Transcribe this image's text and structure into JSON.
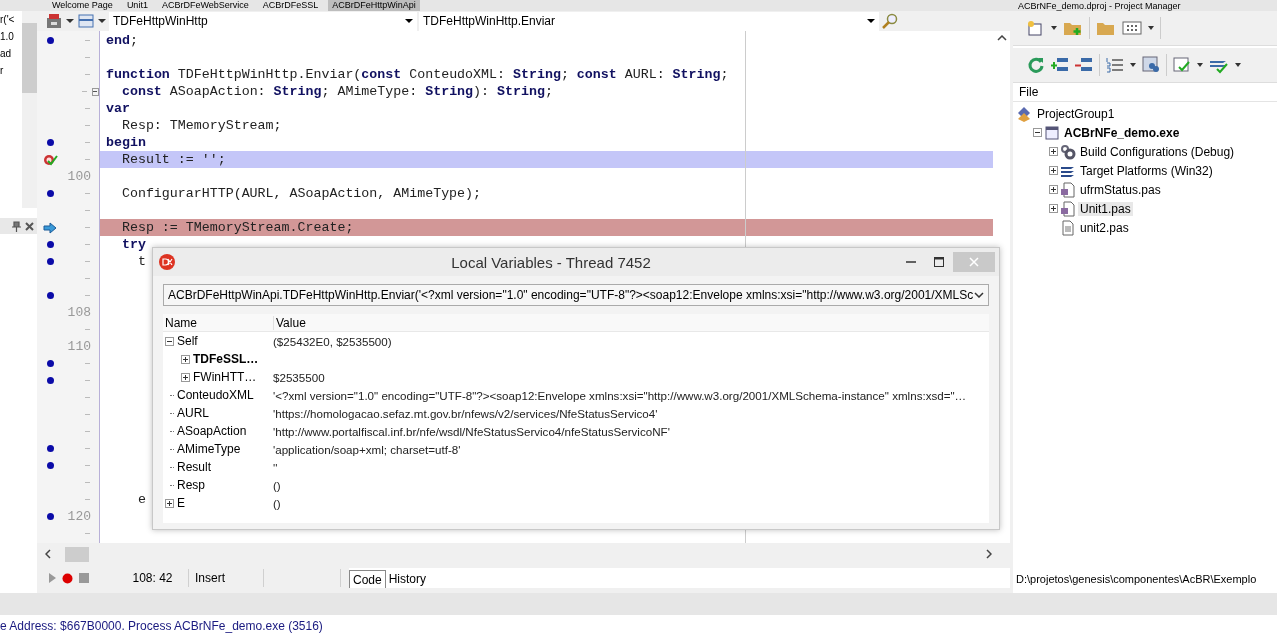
{
  "top_tabs": [
    {
      "label": "Welcome Page",
      "selected": false
    },
    {
      "label": "Unit1",
      "selected": false
    },
    {
      "label": "ACBrDFeWebService",
      "selected": false
    },
    {
      "label": "ACBrDFeSSL",
      "selected": false
    },
    {
      "label": "ACBrDFeHttpWinApi",
      "selected": true
    }
  ],
  "project_manager_title": "ACBrNFe_demo.dproj - Project Manager",
  "left_panel": {
    "lines": [
      "r('<",
      "1.0",
      "ad",
      "r"
    ]
  },
  "editor": {
    "toolbar": {
      "class_combo": "TDFeHttpWinHttp",
      "method_combo": "TDFeHttpWinHttp.Enviar"
    },
    "code_lines": [
      {
        "kind": "plain",
        "dot": true,
        "text": "**end**;"
      },
      {
        "kind": "plain",
        "dot": false
      },
      {
        "kind": "plain",
        "dot": false,
        "text": "**function** TDFeHttpWinHttp.Enviar(**const** ConteudoXML: **String**; **const** AURL: **String**;"
      },
      {
        "kind": "plain",
        "dot": false,
        "fold": true,
        "text": "  **const** ASoapAction: **String**; AMimeType: **String**): **String**;"
      },
      {
        "kind": "plain",
        "dot": false,
        "text": "**var**"
      },
      {
        "kind": "plain",
        "dot": false,
        "text": "  Resp: TMemoryStream;"
      },
      {
        "kind": "plain",
        "dot": true,
        "text": "**begin**"
      },
      {
        "kind": "breakpoint",
        "dot": false,
        "text": "  Result := '';"
      },
      {
        "kind": "plain",
        "dot": false,
        "number": "100"
      },
      {
        "kind": "plain",
        "dot": true,
        "text": "  ConfigurarHTTP(AURL, ASoapAction, AMimeType);"
      },
      {
        "kind": "plain",
        "dot": false
      },
      {
        "kind": "execution",
        "dot": false,
        "text": "  Resp := TMemoryStream.Create;"
      },
      {
        "kind": "plain",
        "dot": true,
        "text": "  **try**"
      },
      {
        "kind": "plain",
        "dot": true,
        "text": "    t"
      },
      {
        "kind": "plain",
        "dot": false
      },
      {
        "kind": "plain",
        "dot": true
      },
      {
        "kind": "plain",
        "dot": false,
        "number": "108"
      },
      {
        "kind": "plain",
        "dot": false
      },
      {
        "kind": "plain",
        "dot": false,
        "number": "110"
      },
      {
        "kind": "plain",
        "dot": true
      },
      {
        "kind": "plain",
        "dot": true
      },
      {
        "kind": "plain",
        "dot": false
      },
      {
        "kind": "plain",
        "dot": false
      },
      {
        "kind": "plain",
        "dot": false
      },
      {
        "kind": "plain",
        "dot": true
      },
      {
        "kind": "plain",
        "dot": true
      },
      {
        "kind": "plain",
        "dot": false
      },
      {
        "kind": "plain",
        "dot": false,
        "text": "    e"
      },
      {
        "kind": "plain",
        "dot": true,
        "number": "120"
      },
      {
        "kind": "plain",
        "dot": false
      }
    ],
    "status": {
      "position": "108: 42",
      "mode": "Insert"
    },
    "view_tabs": [
      {
        "label": "Code",
        "selected": true
      },
      {
        "label": "History",
        "selected": false
      }
    ]
  },
  "project_manager": {
    "column": "File",
    "tree": [
      {
        "label": "ProjectGroup1",
        "kind": "group",
        "selected": false,
        "children": [
          {
            "label": "ACBrNFe_demo.exe",
            "kind": "exe",
            "expanded": true,
            "selected": false,
            "children": [
              {
                "label": "Build Configurations (Debug)",
                "kind": "config",
                "expanded": false,
                "selected": false
              },
              {
                "label": "Target Platforms (Win32)",
                "kind": "platforms",
                "expanded": false,
                "selected": false
              },
              {
                "label": "ufrmStatus.pas",
                "kind": "unit",
                "expanded": false,
                "selected": false
              },
              {
                "label": "Unit1.pas",
                "kind": "unit",
                "expanded": false,
                "selected": true
              },
              {
                "label": "unit2.pas",
                "kind": "file",
                "selected": false
              }
            ]
          }
        ]
      }
    ]
  },
  "status_path": "D:\\projetos\\genesis\\componentes\\AcBR\\Exemplo",
  "messages": [
    "e Address: $667B0000. Process ACBrNFe_demo.exe (3516)"
  ],
  "local_variables": {
    "title": "Local Variables - Thread 7452",
    "frame": "ACBrDFeHttpWinApi.TDFeHttpWinHttp.Enviar('<?xml version=\"1.0\" encoding=\"UTF-8\"?><soap12:Envelope xmlns:xsi=\"http://www.w3.org/2001/XMLSc",
    "columns": [
      "Name",
      "Value"
    ],
    "rows": [
      {
        "name": "Self",
        "bold": false,
        "value": "($25432E0, $2535500)",
        "expanded": true,
        "children": [
          {
            "name": "TDFeSSL…",
            "bold": true,
            "expanded": false
          },
          {
            "name": "FWinHTT…",
            "bold": false,
            "value": "$2535500",
            "expanded": false
          }
        ]
      },
      {
        "name": "ConteudoXML",
        "bold": false,
        "value": "'<?xml version=\"1.0\" encoding=\"UTF-8\"?><soap12:Envelope xmlns:xsi=\"http://www.w3.org/2001/XMLSchema-instance\" xmlns:xsd=\"…"
      },
      {
        "name": "AURL",
        "bold": false,
        "value": "'https://homologacao.sefaz.mt.gov.br/nfews/v2/services/NfeStatusServico4'"
      },
      {
        "name": "ASoapAction",
        "bold": false,
        "value": "'http://www.portalfiscal.inf.br/nfe/wsdl/NfeStatusServico4/nfeStatusServicoNF'"
      },
      {
        "name": "AMimeType",
        "bold": false,
        "value": "'application/soap+xml; charset=utf-8'"
      },
      {
        "name": "Result",
        "bold": false,
        "value": "''"
      },
      {
        "name": "Resp",
        "bold": false,
        "value": "()"
      },
      {
        "name": "E",
        "bold": false,
        "value": "()",
        "expanded": false
      }
    ]
  }
}
